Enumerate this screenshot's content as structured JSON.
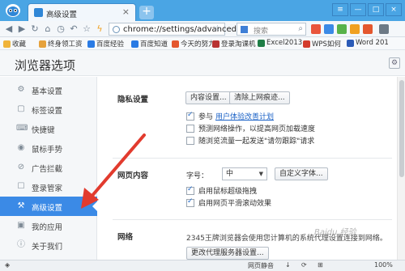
{
  "tab": {
    "title": "高级设置",
    "close": "×",
    "new_tab": "+"
  },
  "window_controls": [
    "≡",
    "—",
    "□",
    "×"
  ],
  "toolbar": {
    "url": "chrome://settings/advanced",
    "search_placeholder": "搜索"
  },
  "bookmarks": [
    {
      "label": "收藏",
      "color": "#f0b43a"
    },
    {
      "label": "终身领工资",
      "color": "#e6a23c"
    },
    {
      "label": "百度经验",
      "color": "#2a7be4"
    },
    {
      "label": "百度知道",
      "color": "#2a7be4"
    },
    {
      "label": "今天的努力",
      "color": "#e4572e"
    },
    {
      "label": "登录淘课机",
      "color": "#b83232"
    },
    {
      "label": "Excel2013",
      "color": "#1e7d46"
    },
    {
      "label": "WPS如何",
      "color": "#d33b2c"
    },
    {
      "label": "Word 201",
      "color": "#2b5bb7"
    }
  ],
  "page": {
    "title": "浏览器选项"
  },
  "sidebar": {
    "items": [
      {
        "label": "基本设置",
        "icon": "⚙"
      },
      {
        "label": "标签设置",
        "icon": "▢"
      },
      {
        "label": "快捷键",
        "icon": "⌨"
      },
      {
        "label": "鼠标手势",
        "icon": "◉"
      },
      {
        "label": "广告拦截",
        "icon": "⊘"
      },
      {
        "label": "登录管家",
        "icon": "☐"
      },
      {
        "label": "高级设置",
        "icon": "🔧",
        "active": true
      },
      {
        "label": "我的应用",
        "icon": "▣"
      },
      {
        "label": "关于我们",
        "icon": "ⓘ"
      }
    ]
  },
  "privacy": {
    "label": "隐私设置",
    "btn_content": "内容设置...",
    "btn_clear": "清除上网痕迹...",
    "opt1_prefix": "参与",
    "opt1_link": "用户体验改善计划",
    "opt1_checked": true,
    "opt2": "预测网络操作，以提高网页加载速度",
    "opt2_checked": false,
    "opt3": "随浏览流量一起发送\"请勿跟踪\"请求",
    "opt3_checked": false
  },
  "webcontent": {
    "label": "网页内容",
    "font_size_label": "字号：",
    "font_size_value": "中",
    "btn_custom_font": "自定义字体...",
    "opt_mouse_drag": "启用鼠标超级拖拽",
    "opt_mouse_drag_checked": true,
    "opt_smooth_scroll": "启用网页平滑滚动效果",
    "opt_smooth_scroll_checked": true
  },
  "network": {
    "label": "网络",
    "desc": "2345王牌浏览器会使用您计算机的系统代理设置连接到网络。",
    "btn_proxy": "更改代理服务器设置..."
  },
  "statusbar": {
    "items": [
      "网页静音",
      "↓",
      "⟳",
      "⊞",
      "100%"
    ]
  },
  "watermark": "Baidu 经验"
}
